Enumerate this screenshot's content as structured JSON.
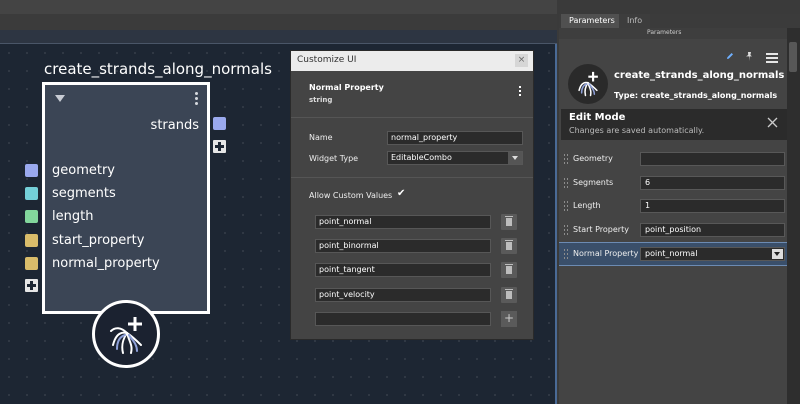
{
  "node": {
    "title": "create_strands_along_normals",
    "output_label": "strands",
    "inputs": [
      "geometry",
      "segments",
      "length",
      "start_property",
      "normal_property"
    ]
  },
  "colors": {
    "port_blue": "#9aa9ee",
    "port_cyan": "#74cfd8",
    "port_green": "#82d69c",
    "port_yellow": "#d9bc6a",
    "accent_blue": "#6c8bb3"
  },
  "dialog": {
    "title": "Customize UI",
    "close_glyph": "×",
    "property_title": "Normal Property",
    "property_type": "string",
    "name_label": "Name",
    "name_value": "normal_property",
    "widget_label": "Widget Type",
    "widget_value": "EditableCombo",
    "allow_custom_label": "Allow Custom Values",
    "checkmark": "✔",
    "values": [
      "point_normal",
      "point_binormal",
      "point_tangent",
      "point_velocity"
    ],
    "new_value": "",
    "add_glyph": "+"
  },
  "panel": {
    "tabs": [
      "Parameters",
      "Info"
    ],
    "strip_label": "Parameters",
    "hda_name": "create_strands_along_normals",
    "hda_type": "Type: create_strands_along_normals",
    "edit_mode_title": "Edit Mode",
    "edit_mode_sub": "Changes are saved automatically.",
    "params": [
      {
        "label": "Geometry",
        "value": ""
      },
      {
        "label": "Segments",
        "value": "6"
      },
      {
        "label": "Length",
        "value": "1"
      },
      {
        "label": "Start Property",
        "value": "point_position"
      },
      {
        "label": "Normal Property",
        "value": "point_normal"
      }
    ]
  }
}
